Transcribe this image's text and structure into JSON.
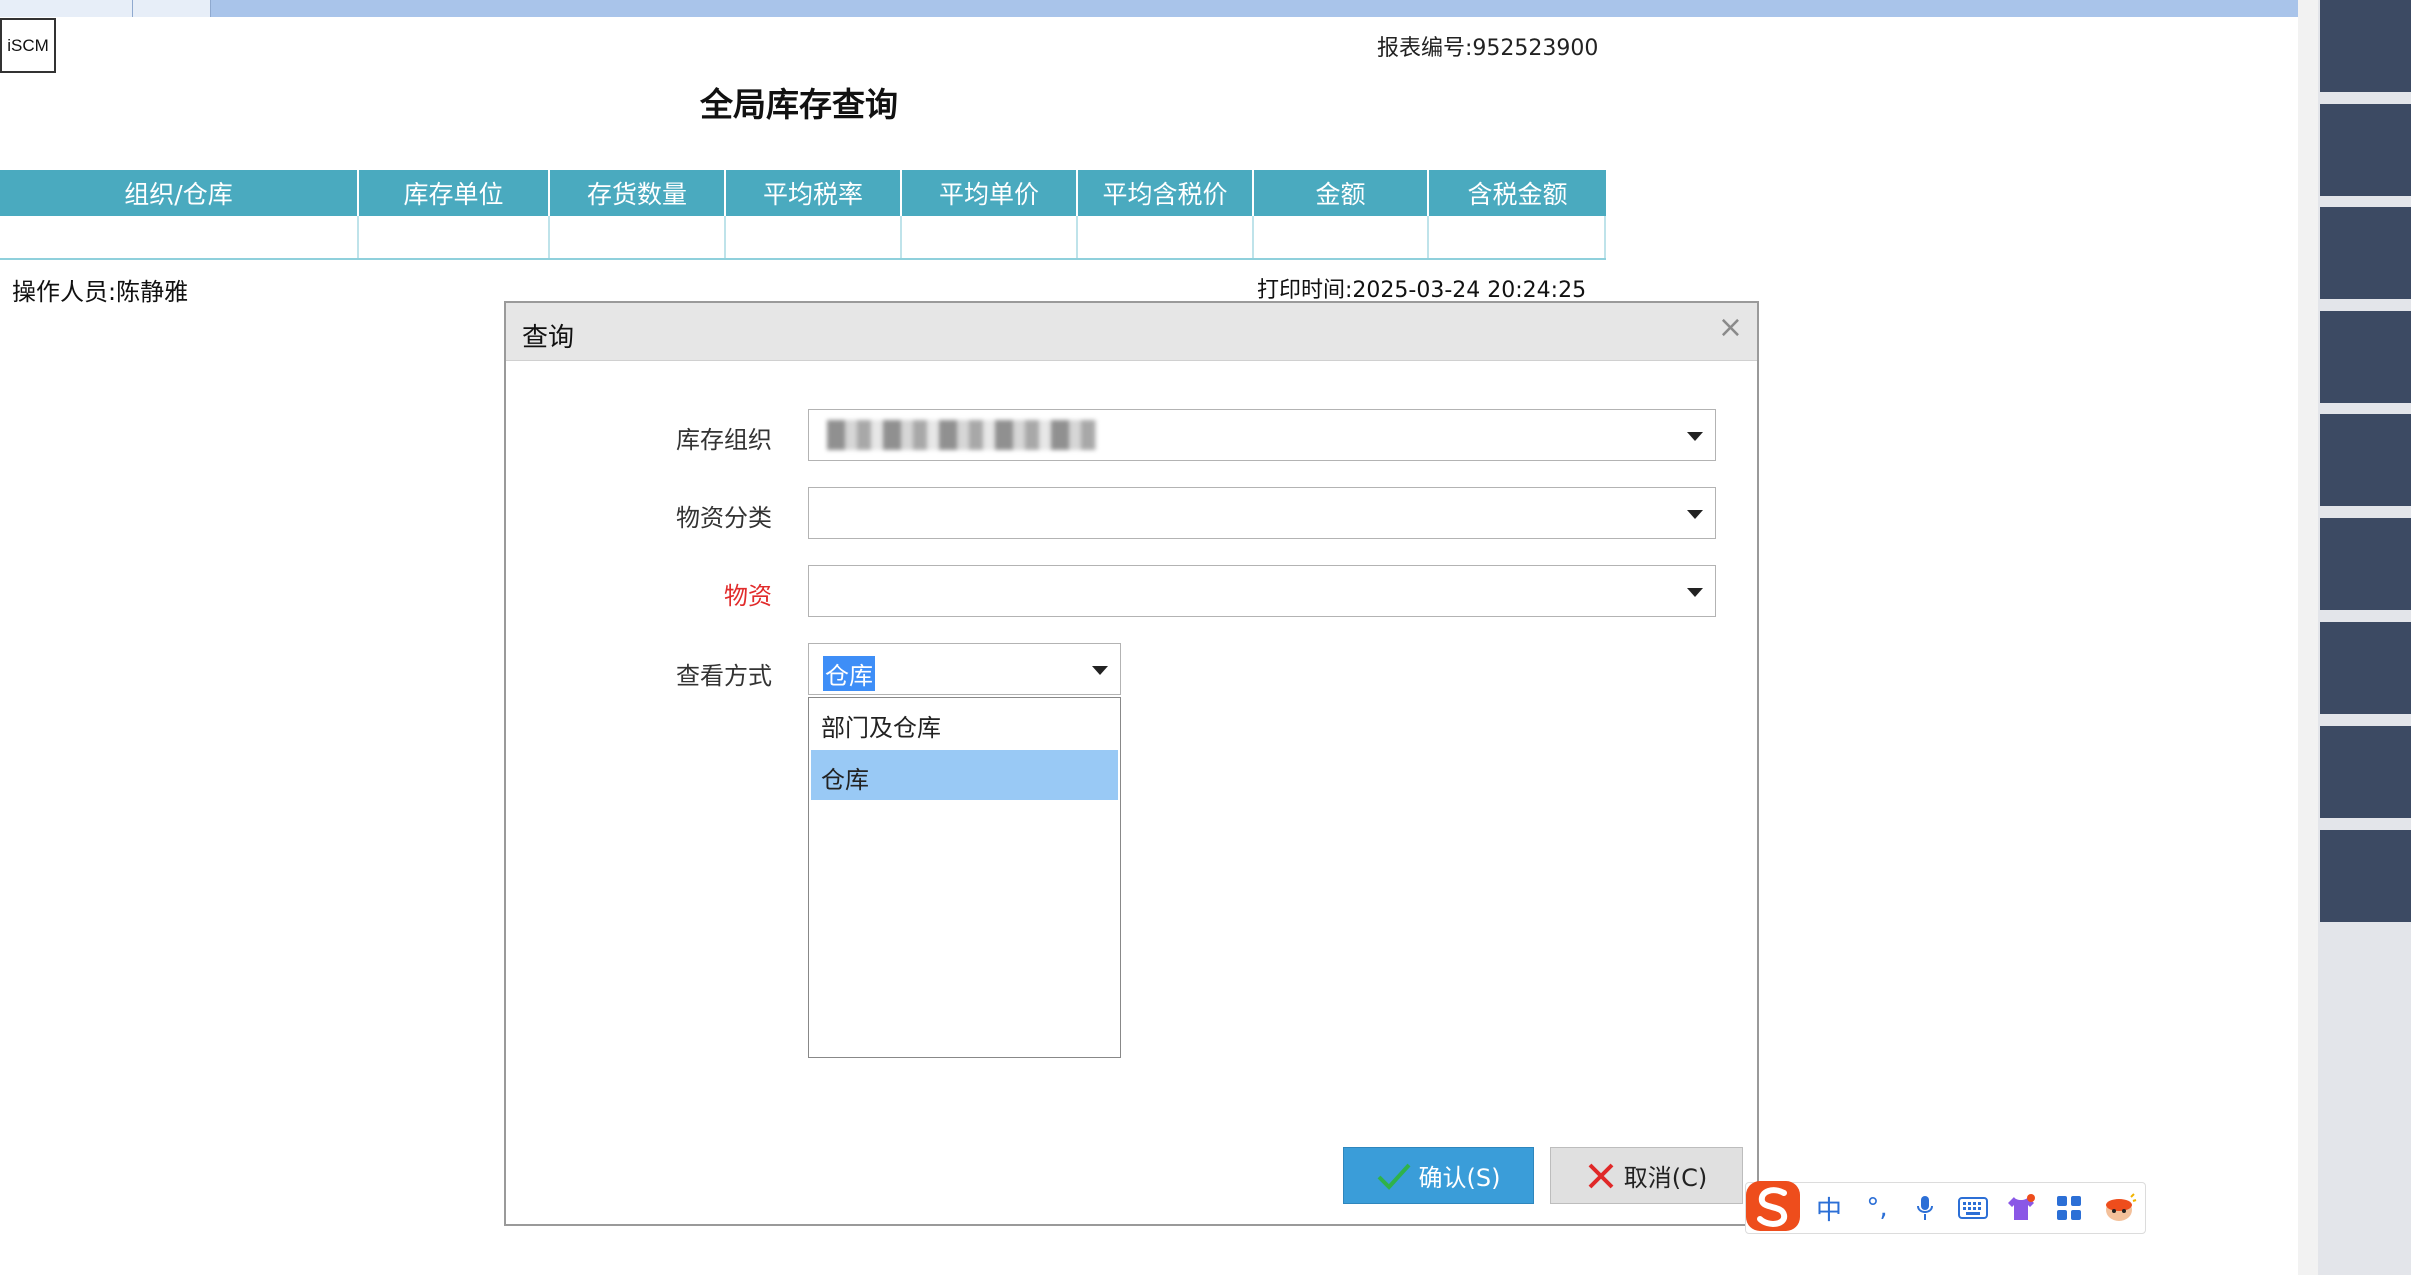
{
  "report": {
    "logo": "iSCM",
    "report_no_label": "报表编号:",
    "report_no_value": "952523900",
    "title": "全局库存查询",
    "operator": "操作人员:陈静雅",
    "print_time": "打印时间:2025-03-24 20:24:25",
    "columns": [
      "组织/仓库",
      "库存单位",
      "存货数量",
      "平均税率",
      "平均单价",
      "平均含税价",
      "金额",
      "含税金额"
    ]
  },
  "dialog": {
    "title": "查询",
    "close_symbol": "×",
    "fields": {
      "inventory_org_label": "库存组织",
      "material_category_label": "物资分类",
      "material_label": "物资",
      "view_mode_label": "查看方式",
      "view_mode_value": "仓库"
    },
    "view_mode_options": [
      "部门及仓库",
      "仓库"
    ],
    "confirm_label": "确认(S)",
    "cancel_label": "取消(C)"
  },
  "ime": {
    "mode": "中",
    "punct": "°,"
  },
  "colors": {
    "header_teal": "#4aaabf",
    "confirm_blue": "#3a9dd9",
    "side_tiles": "#3c4a63",
    "required_red": "#e12b2b"
  }
}
